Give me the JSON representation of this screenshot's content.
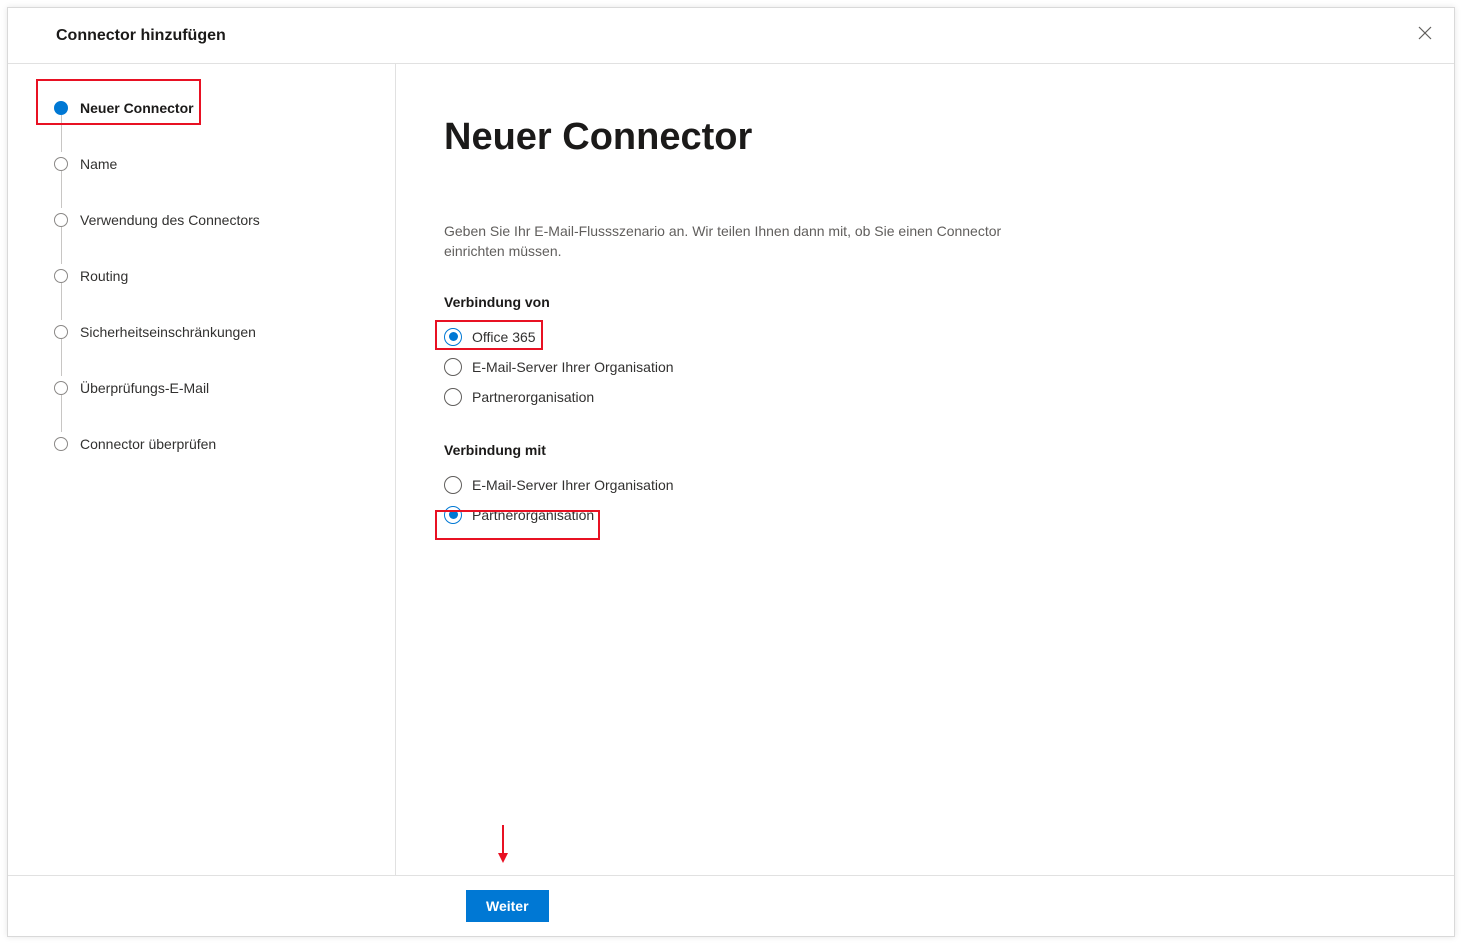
{
  "header": {
    "title": "Connector hinzufügen"
  },
  "sidebar": {
    "steps": [
      {
        "label": "Neuer Connector",
        "active": true
      },
      {
        "label": "Name",
        "active": false
      },
      {
        "label": "Verwendung des Connectors",
        "active": false
      },
      {
        "label": "Routing",
        "active": false
      },
      {
        "label": "Sicherheitseinschränkungen",
        "active": false
      },
      {
        "label": "Überprüfungs-E-Mail",
        "active": false
      },
      {
        "label": "Connector überprüfen",
        "active": false
      }
    ]
  },
  "main": {
    "title": "Neuer Connector",
    "description": "Geben Sie Ihr E-Mail-Flussszenario an. Wir teilen Ihnen dann mit, ob Sie einen Connector einrichten müssen.",
    "from_section": {
      "label": "Verbindung von",
      "options": [
        {
          "label": "Office 365",
          "selected": true
        },
        {
          "label": "E-Mail-Server Ihrer Organisation",
          "selected": false
        },
        {
          "label": "Partnerorganisation",
          "selected": false
        }
      ]
    },
    "to_section": {
      "label": "Verbindung mit",
      "options": [
        {
          "label": "E-Mail-Server Ihrer Organisation",
          "selected": false
        },
        {
          "label": "Partnerorganisation",
          "selected": true
        }
      ]
    }
  },
  "footer": {
    "next_label": "Weiter"
  }
}
